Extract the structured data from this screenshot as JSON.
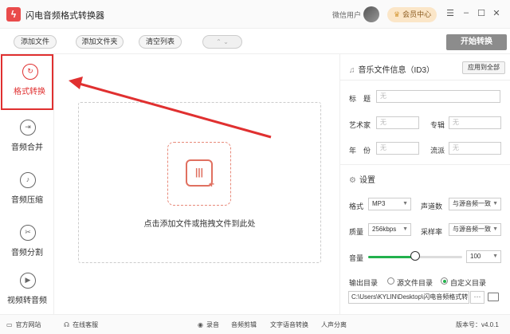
{
  "window": {
    "title": "闪电音频格式转换器",
    "logo_glyph": "ϟ"
  },
  "header": {
    "user_name": "微信用户",
    "vip_label": "会员中心",
    "minimize": "–",
    "maximize": "☐",
    "close": "✕",
    "menu": "☰"
  },
  "toolbar": {
    "add_file": "添加文件",
    "add_folder": "添加文件夹",
    "clear_list": "清空列表",
    "dropdown": "⌃ ⌄",
    "start": "开始转换"
  },
  "sidebar": {
    "items": [
      {
        "label": "格式转换",
        "icon": "↻",
        "active": true
      },
      {
        "label": "音频合并",
        "icon": "⇥"
      },
      {
        "label": "音频压缩",
        "icon": "♪"
      },
      {
        "label": "音频分割",
        "icon": "✂"
      },
      {
        "label": "视频转音频",
        "icon": "▶"
      }
    ]
  },
  "dropzone": {
    "text": "点击添加文件或拖拽文件到此处",
    "icon_glyph": "|||",
    "plus": "+"
  },
  "id3": {
    "title": "音乐文件信息（ID3）",
    "apply_all": "应用到全部",
    "fields": {
      "title_label": "标　题",
      "title_placeholder": "无",
      "artist_label": "艺术家",
      "artist_placeholder": "无",
      "album_label": "专辑",
      "album_placeholder": "无",
      "year_label": "年　份",
      "year_placeholder": "无",
      "genre_label": "流派",
      "genre_placeholder": "无"
    }
  },
  "settings": {
    "title": "设置",
    "format_label": "格式",
    "format_value": "MP3",
    "channels_label": "声道数",
    "channels_value": "与源音频一致",
    "quality_label": "质量",
    "quality_value": "256kbps",
    "samplerate_label": "采样率",
    "samplerate_value": "与源音频一致",
    "volume_label": "音量",
    "volume_value": "100",
    "volume_fraction": 0.5,
    "output_label": "输出目录",
    "output_source": "源文件目录",
    "output_custom": "自定义目录",
    "output_path": "C:\\Users\\KYLIN\\Desktop\\闪电音频格式转",
    "path_more": "···"
  },
  "statusbar": {
    "website": "官方网站",
    "support": "在线客服",
    "record": "录音",
    "audio_edit": "音频剪辑",
    "tts": "文字语音转换",
    "vocal_split": "人声分离",
    "version": "版本号：v4.0.1"
  },
  "colors": {
    "accent_red": "#e03030",
    "green": "#22b14c",
    "vip_bg": "#fbe6c8"
  }
}
